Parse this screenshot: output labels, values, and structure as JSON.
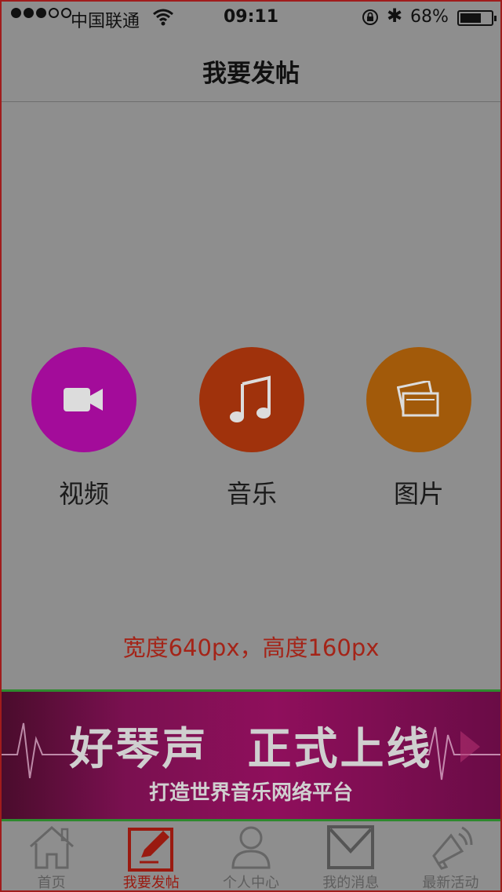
{
  "status_bar": {
    "carrier": "中国联通",
    "time": "09:11",
    "battery_percent": "68%",
    "battery_level": 0.68
  },
  "nav": {
    "title": "我要发帖"
  },
  "options": [
    {
      "label": "视频",
      "icon": "video-camera-icon",
      "color": "#a30c9a"
    },
    {
      "label": "音乐",
      "icon": "music-note-icon",
      "color": "#a0320c"
    },
    {
      "label": "图片",
      "icon": "picture-icon",
      "color": "#a25a0a"
    }
  ],
  "hint": "宽度640px，高度160px",
  "banner": {
    "title_left": "好琴声",
    "title_right": "正式上线",
    "subtitle": "打造世界音乐网络平台"
  },
  "tabs": [
    {
      "label": "首页",
      "icon": "home-icon",
      "active": false
    },
    {
      "label": "我要发帖",
      "icon": "compose-icon",
      "active": true
    },
    {
      "label": "个人中心",
      "icon": "user-icon",
      "active": false
    },
    {
      "label": "我的消息",
      "icon": "mail-icon",
      "active": false
    },
    {
      "label": "最新活动",
      "icon": "megaphone-icon",
      "active": false
    }
  ]
}
